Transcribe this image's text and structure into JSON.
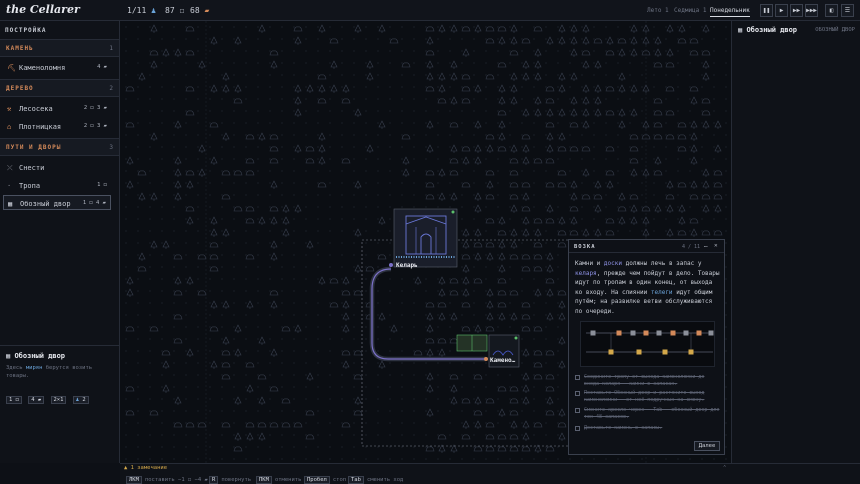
{
  "app": {
    "title": "the Cellarer"
  },
  "top": {
    "pop": "1/11",
    "stone": "87",
    "wood": "68",
    "time_tabs": [
      "Лето 1",
      "Седмица 1",
      "Понедельник"
    ],
    "controls": [
      "pause",
      "play",
      "fast",
      "fastest",
      "panel"
    ]
  },
  "build": {
    "header": "ПОСТРОЙКА",
    "sections": [
      {
        "label": "КАМЕНЬ",
        "key": "1",
        "items": [
          {
            "name": "Каменоломня",
            "cost": "4 ▰"
          }
        ]
      },
      {
        "label": "ДЕРЕВО",
        "key": "2",
        "items": [
          {
            "name": "Лесосека",
            "cost": "2 ◻ 3 ▰"
          },
          {
            "name": "Плотницкая",
            "cost": "2 ◻ 3 ▰"
          }
        ]
      },
      {
        "label": "ПУТИ И ДВОРЫ",
        "key": "3",
        "items": [
          {
            "name": "Снести",
            "cost": ""
          },
          {
            "name": "Тропа",
            "cost": "1 ◻"
          },
          {
            "name": "Обозный двор",
            "cost": "1 ◻ 4 ▰"
          }
        ]
      }
    ]
  },
  "info": {
    "title": "Обозный двор",
    "desc_pre": "Здесь",
    "desc_hl": "мирян",
    "desc_post": "берутся возить товары.",
    "stats": [
      "1 ◻",
      "4 ▰",
      "2×1",
      "2"
    ]
  },
  "right": {
    "title": "Обозный двор",
    "tag": "ОБОЗНЫЙ ДВОР"
  },
  "map_labels": {
    "keeper": "Келарь",
    "quarry": "Камено…"
  },
  "tutorial": {
    "title": "ВОЗКА",
    "page": "4 / 11",
    "p1": "Камни и",
    "p_hl1": "доски",
    "p2": "должны лечь в запас у",
    "p_hl2": "келаря",
    "p3": ", прежде чем пойдут в дело. Товары идут по тропам в один конец, от выхода ко входу. На слиянии",
    "p_hl3": "телеги",
    "p4": "идут общим путём; на развилке ветви обслуживаются по очереди.",
    "checks": [
      "Соедините тропу от выхода каменоломни до входа келаря — камни в запасах.",
      "Поставьте Обозный двор и растяните выход каменоломни — от неё подручных на смену.",
      "Смените кресло через — Tab — обозный двор для тех 48 запасов.",
      "Доставьте камень в запасы."
    ],
    "next": "Далее"
  },
  "bottom": {
    "notice": "▲ 1 замечание",
    "hints": [
      {
        "key": "ЛКМ",
        "text": "поставить −1 ◻ −4 ▰"
      },
      {
        "key": "R",
        "text": "повернуть"
      },
      {
        "key": "ПКМ",
        "text": "отменить"
      },
      {
        "key": "Пробел",
        "text": "стоп"
      },
      {
        "key": "Tab",
        "text": "сменить ход"
      }
    ]
  }
}
